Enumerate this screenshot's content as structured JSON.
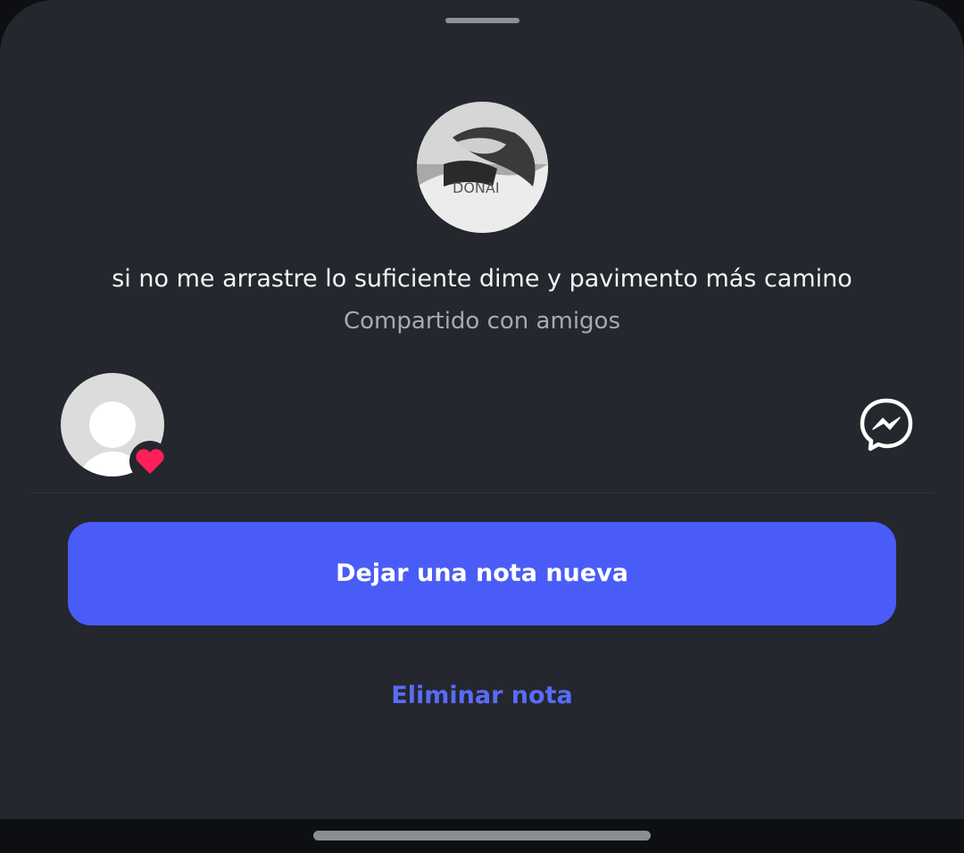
{
  "note": {
    "text": "si no me arrastre lo suficiente dime y pavimento más camino",
    "audience": "Compartido con amigos"
  },
  "reaction": {
    "type": "heart-icon",
    "color": "#ff1f5a"
  },
  "share": {
    "icon": "messenger-icon"
  },
  "actions": {
    "primary_label": "Dejar una nota nueva",
    "delete_label": "Eliminar nota"
  },
  "theme": {
    "sheet_bg": "#24272d",
    "accent": "#4a5cf7",
    "link": "#5a6bf7"
  }
}
